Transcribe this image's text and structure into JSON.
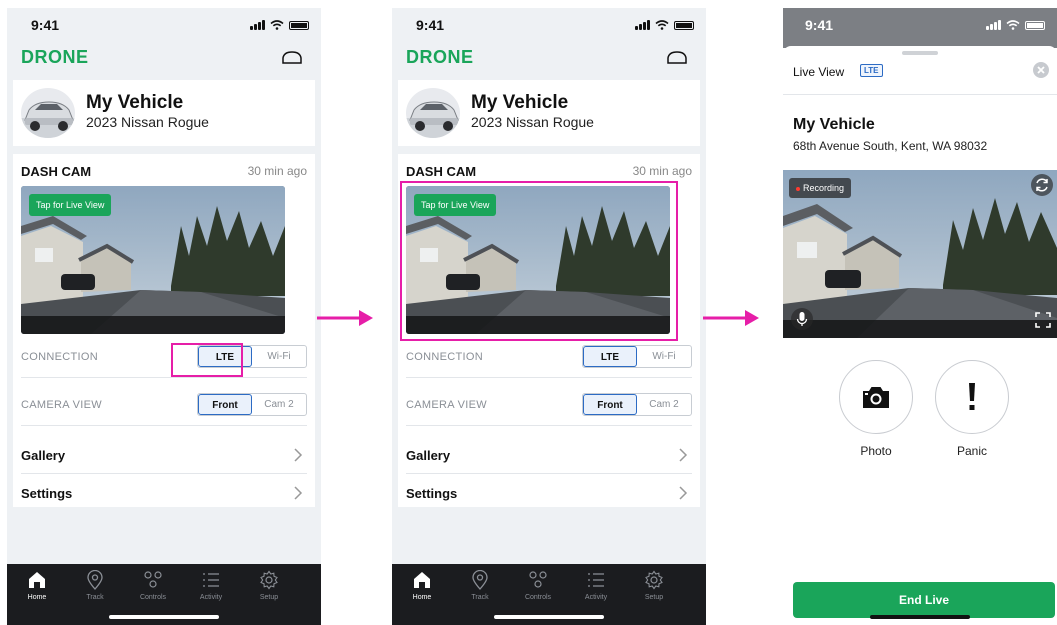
{
  "status_time": "9:41",
  "brand": "DRONE",
  "vehicle": {
    "name": "My Vehicle",
    "model": "2023 Nissan Rogue",
    "address": "68th Avenue South, Kent, WA 98032"
  },
  "dashcam": {
    "title": "DASH CAM",
    "updated": "30 min ago",
    "tap_label": "Tap for Live View",
    "connection_label": "CONNECTION",
    "connection_options": [
      "LTE",
      "Wi-Fi"
    ],
    "connection_selected": "LTE",
    "camera_label": "CAMERA VIEW",
    "camera_options": [
      "Front",
      "Cam 2"
    ],
    "camera_selected": "Front"
  },
  "menu": {
    "gallery": "Gallery",
    "settings": "Settings"
  },
  "tabs": [
    {
      "label": "Home",
      "icon": "home-icon"
    },
    {
      "label": "Track",
      "icon": "location-pin-icon"
    },
    {
      "label": "Controls",
      "icon": "controls-icon"
    },
    {
      "label": "Activity",
      "icon": "list-icon"
    },
    {
      "label": "Setup",
      "icon": "gear-icon"
    }
  ],
  "live_view": {
    "title": "Live View",
    "connection_badge": "LTE",
    "recording_label": "Recording",
    "photo_label": "Photo",
    "panic_label": "Panic",
    "end_label": "End Live"
  },
  "colors": {
    "brand_green": "#1aa55a",
    "highlight_magenta": "#e61ea8",
    "tab_bar": "#1b1c1f",
    "selected_blue": "#2c6bc4"
  }
}
